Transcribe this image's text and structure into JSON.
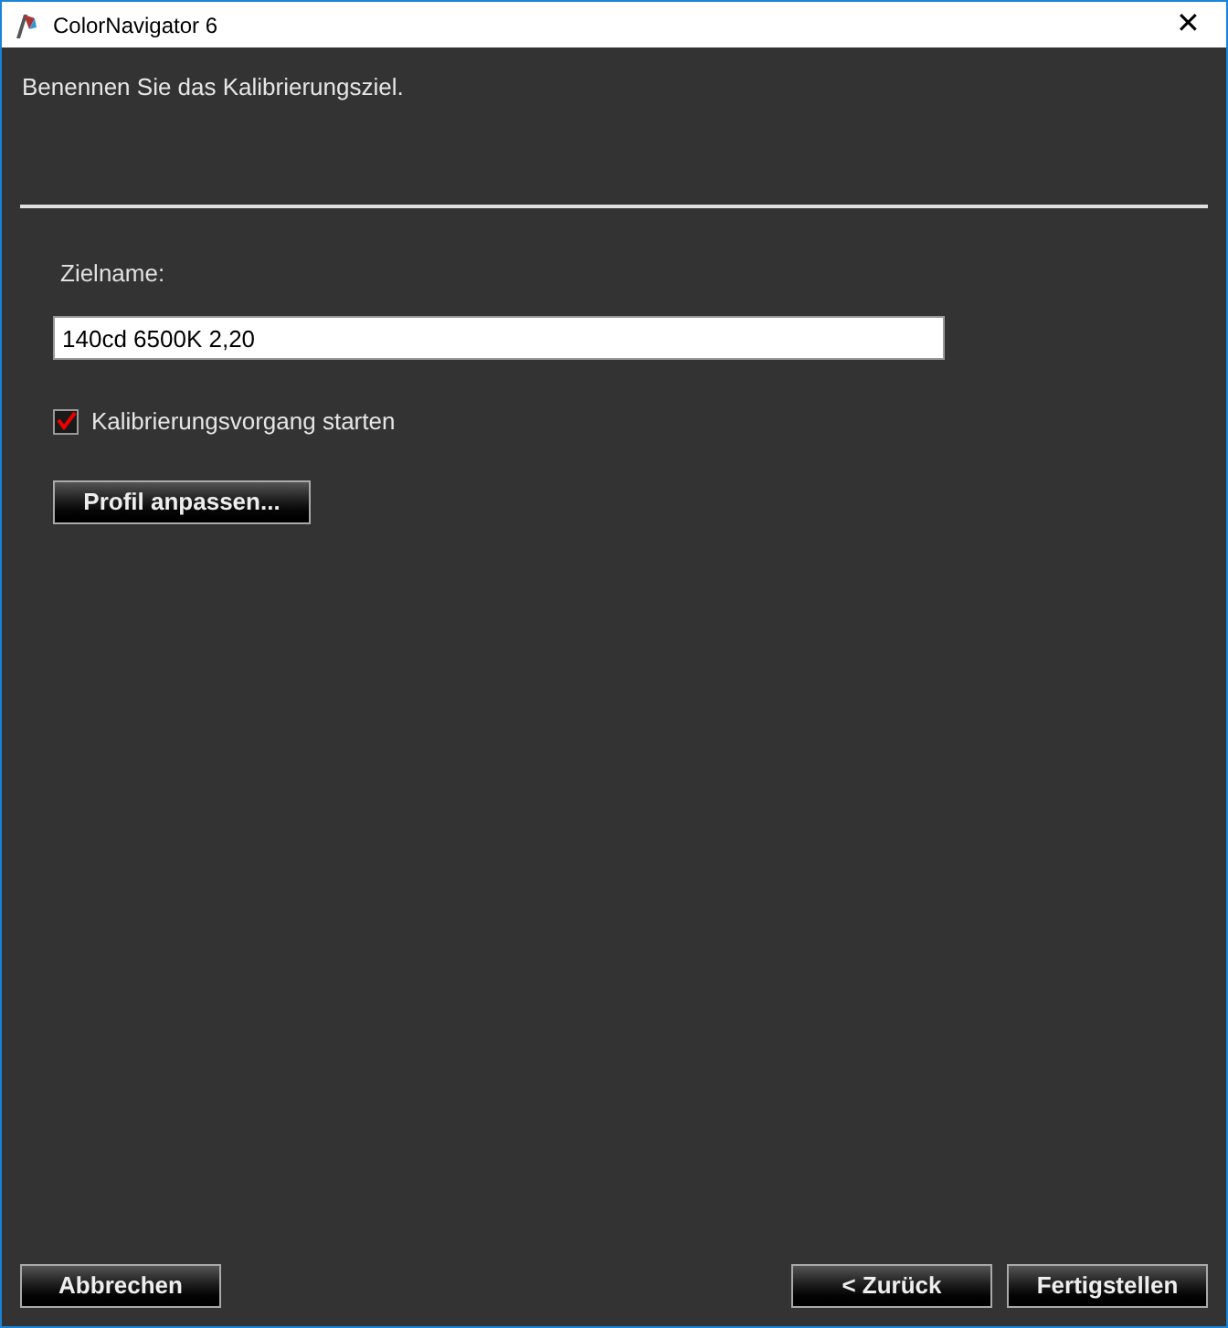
{
  "window": {
    "title": "ColorNavigator 6",
    "close": "✕"
  },
  "heading": "Benennen Sie das Kalibrierungsziel.",
  "target_name": {
    "label": "Zielname:",
    "value": "140cd 6500K 2,20"
  },
  "start_calibration": {
    "label": "Kalibrierungsvorgang starten",
    "checked": true
  },
  "adjust_profile_button": "Profil anpassen...",
  "left_buttons": [
    "Abbrechen"
  ],
  "right_buttons": [
    "< Zurück",
    "Fertigstellen"
  ]
}
